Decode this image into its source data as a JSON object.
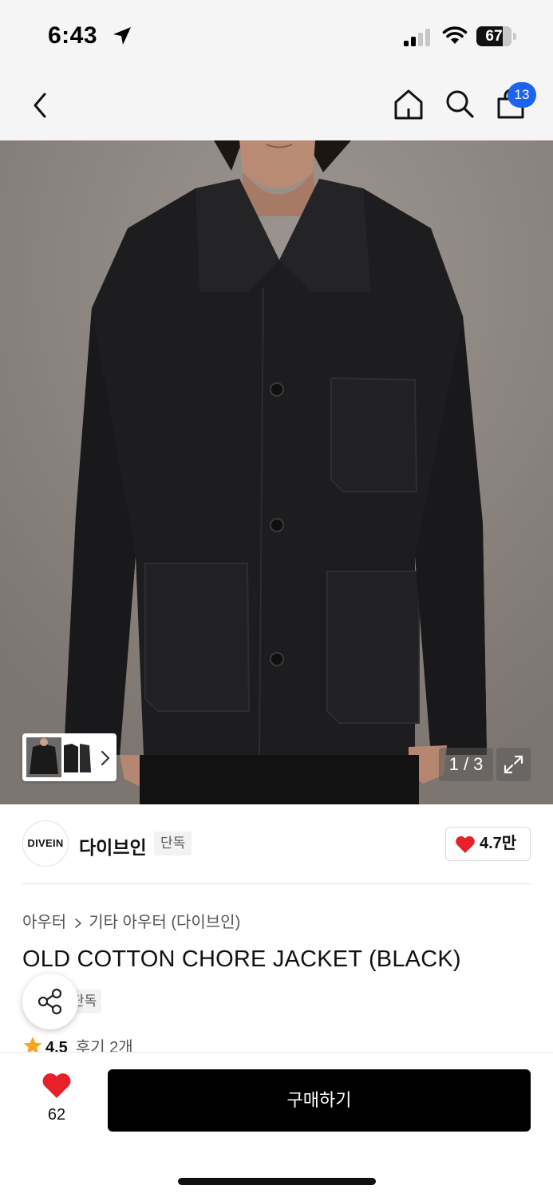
{
  "status_bar": {
    "time": "6:43",
    "battery": "67"
  },
  "header": {
    "cart_count": "13"
  },
  "gallery": {
    "counter": "1 / 3"
  },
  "brand": {
    "logo_text": "DIVEIN",
    "name": "다이브인",
    "tag": "단독",
    "likes": "4.7만"
  },
  "product": {
    "breadcrumb": [
      "아우터",
      "기타 아우터 (다이브인)"
    ],
    "title": "OLD COTTON CHORE JACKET (BLACK)",
    "tag": "단독",
    "rating": "4.5",
    "review_text": "후기 2개"
  },
  "bottom_bar": {
    "wish_count": "62",
    "buy_label": "구매하기"
  },
  "colors": {
    "accent_blue": "#1e63f0",
    "heart_red": "#e8202a",
    "star_orange": "#f5a623",
    "buy_button": "#000000"
  },
  "icons": [
    "location-arrow-icon",
    "signal-icon",
    "wifi-icon",
    "battery-icon",
    "back-icon",
    "home-icon",
    "search-icon",
    "shopping-bag-icon",
    "chevron-right-icon",
    "expand-icon",
    "heart-icon",
    "share-icon",
    "star-icon"
  ]
}
